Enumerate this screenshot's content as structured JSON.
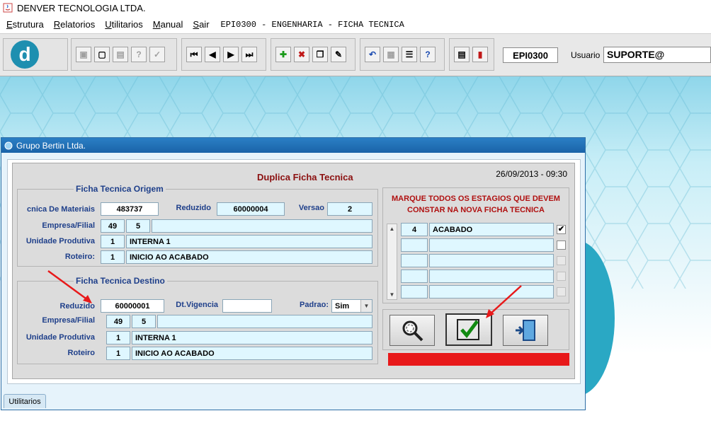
{
  "app": {
    "title": "DENVER TECNOLOGIA LTDA."
  },
  "menu": {
    "items": [
      "Estrutura",
      "Relatorios",
      "Utilitarios",
      "Manual",
      "Sair"
    ],
    "form_title": "EPI0300 - ENGENHARIA - FICHA TECNICA"
  },
  "toolbar": {
    "logo_letter": "d",
    "form_code": "EPI0300",
    "user_label": "Usuario",
    "user_value": "SUPORTE@"
  },
  "window": {
    "title": "Grupo Bertin Ltda.",
    "heading": "Duplica Ficha Tecnica",
    "datetime": "26/09/2013 - 09:30"
  },
  "origem": {
    "frame_title": "Ficha Tecnica Origem",
    "lista_label": "cnica De Materiais",
    "lista_value": "483737",
    "reduzido_label": "Reduzido",
    "reduzido_value": "60000004",
    "versao_label": "Versao",
    "versao_value": "2",
    "empresa_label": "Empresa/Filial",
    "empresa_value": "49",
    "filial_value": "5",
    "unidade_label": "Unidade Produtiva",
    "unidade_code": "1",
    "unidade_name": "INTERNA 1",
    "roteiro_label": "Roteiro:",
    "roteiro_code": "1",
    "roteiro_name": "INICIO AO ACABADO"
  },
  "destino": {
    "frame_title": "Ficha Tecnica Destino",
    "reduzido_label": "Reduzido",
    "reduzido_value": "60000001",
    "vigencia_label": "Dt.Vigencia",
    "vigencia_value": "",
    "padrao_label": "Padrao:",
    "padrao_value": "Sim",
    "empresa_label": "Empresa/Filial",
    "empresa_value": "49",
    "filial_value": "5",
    "unidade_label": "Unidade Produtiva",
    "unidade_code": "1",
    "unidade_name": "INTERNA 1",
    "roteiro_label": "Roteiro",
    "roteiro_code": "1",
    "roteiro_name": "INICIO AO ACABADO"
  },
  "estagios": {
    "title_line1": "MARQUE TODOS OS ESTAGIOS QUE DEVEM",
    "title_line2": "CONSTAR NA NOVA FICHA TECNICA",
    "rows": [
      {
        "code": "4",
        "name": "ACABADO",
        "checked": "✔"
      },
      {
        "code": "",
        "name": "",
        "checked": ""
      },
      {
        "code": "",
        "name": "",
        "checked": ""
      },
      {
        "code": "",
        "name": "",
        "checked": ""
      },
      {
        "code": "",
        "name": "",
        "checked": ""
      }
    ]
  },
  "tabs": {
    "utilitarios": "Utilitarios"
  },
  "colors": {
    "accent": "#1e3f8a",
    "heading": "#8b1010",
    "alert_bar": "#e8191a",
    "field": "#dff7ff"
  }
}
